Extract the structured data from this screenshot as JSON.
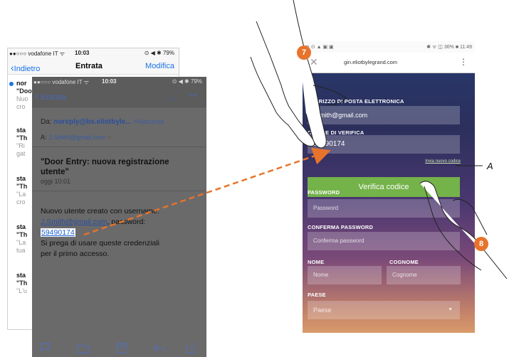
{
  "inbox": {
    "status": {
      "carrier": "●●○○○ vodafone IT ᯤ",
      "time": "10:03",
      "battery": "⊙ ◀ ✱ 79%"
    },
    "nav": {
      "back": "Indietro",
      "title": "Entrata",
      "edit": "Modifica"
    },
    "items": [
      {
        "sender": "nor",
        "subject": "\"Doo",
        "preview1": "Nuo",
        "preview2": "cro"
      },
      {
        "sender": "sta",
        "subject": "\"Th",
        "preview1": "\"Ri",
        "preview2": "gat"
      },
      {
        "sender": "sta",
        "subject": "\"Th",
        "preview1": "\"La",
        "preview2": "cro"
      },
      {
        "sender": "sta",
        "subject": "\"Th",
        "preview1": "\"La",
        "preview2": "tua"
      },
      {
        "sender": "sta",
        "subject": "\"Th",
        "preview1": "\"L'u",
        "preview2": ""
      }
    ]
  },
  "mail": {
    "status": {
      "carrier": "●●○○○ vodafone IT ᯤ",
      "time": "10:03",
      "battery": "⊙ ◀ ✱ 79%"
    },
    "nav": {
      "back": "Entrata"
    },
    "from_label": "Da:",
    "from": "noreply@bs.eliotbyle...",
    "hide": "Nascondi",
    "to_label": "A:",
    "to": "J.Smith@gmail.com",
    "subject_line1": "\"Door Entry: nuova registrazione",
    "subject_line2": "utente\"",
    "date": "oggi 10:01",
    "body1": "Nuovo utente creato con username:",
    "username": "J.Smith@gmail.com",
    "body2": ", password:",
    "password": "59490174",
    "body3": "Si prega di usare queste credenziali",
    "body4": "per il primo accesso."
  },
  "reg": {
    "status": {
      "left": "⊃ ⊙ ▲ ▣ ▣",
      "right": "✱ ᯤ ◫ 36% ■ 11:49"
    },
    "url": "gin.eliotbylegrand.com",
    "email_label": "INDIRIZZO DI POSTA ELETTRONICA",
    "email_value": "j.smith@gmail.com",
    "code_label": "CODICE DI VERIFICA",
    "code_value": "59490174",
    "resend": "Invia nuovo codice",
    "verify": "Verifica codice",
    "password_label": "PASSWORD",
    "password_ph": "Password",
    "confirm_label": "CONFERMA PASSWORD",
    "confirm_ph": "Conferma password",
    "name_label": "NOME",
    "name_ph": "Nome",
    "surname_label": "COGNOME",
    "surname_ph": "Cognome",
    "country_label": "PAESE",
    "country_ph": "Paese"
  },
  "annotations": {
    "step7": "7",
    "step8": "8",
    "callout": "A",
    "accent": "#e8732c"
  }
}
